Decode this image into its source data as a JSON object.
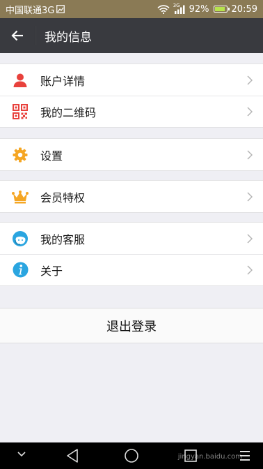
{
  "status_bar": {
    "carrier": "中国联通3G",
    "network_small": "3G",
    "battery_percent": "92%",
    "time": "20:59",
    "battery_level": 0.92
  },
  "nav": {
    "title": "我的信息"
  },
  "menu": {
    "groups": [
      {
        "items": [
          {
            "label": "账户详情",
            "icon": "person-icon",
            "color": "#e8413c"
          },
          {
            "label": "我的二维码",
            "icon": "qr-code-icon",
            "color": "#e8413c"
          }
        ]
      },
      {
        "items": [
          {
            "label": "设置",
            "icon": "gear-icon",
            "color": "#f5a623"
          }
        ]
      },
      {
        "items": [
          {
            "label": "会员特权",
            "icon": "crown-icon",
            "color": "#f5a623"
          }
        ]
      },
      {
        "items": [
          {
            "label": "我的客服",
            "icon": "customer-service-icon",
            "color": "#2aa5e0"
          },
          {
            "label": "关于",
            "icon": "info-icon",
            "color": "#2aa5e0"
          }
        ]
      }
    ]
  },
  "logout_label": "退出登录",
  "watermark": "jingyan.baidu.com"
}
